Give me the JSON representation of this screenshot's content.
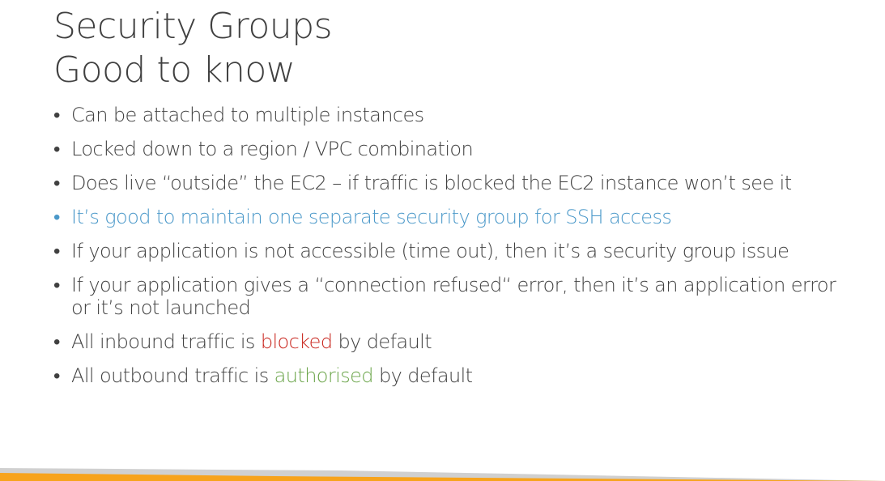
{
  "slide": {
    "title_line1": "Security Groups",
    "title_line2": "Good to know",
    "bullet_char": "•",
    "bullets": [
      {
        "text": "Can be attached to multiple instances"
      },
      {
        "text": "Locked down to a region / VPC combination"
      },
      {
        "text": "Does live “outside” the EC2 – if traffic is blocked the EC2 instance won’t see it"
      },
      {
        "text": "It’s good to maintain one separate security group for SSH access"
      },
      {
        "text": "If your application is not accessible (time out), then it’s a security group issue"
      },
      {
        "text": "If your application gives a “connection refused“ error, then it’s an application error or it’s not launched"
      },
      {
        "before": "All inbound traffic is ",
        "highlight": "blocked",
        "after": " by default"
      },
      {
        "before": "All outbound traffic is ",
        "highlight": "authorised",
        "after": " by default"
      }
    ]
  },
  "colors": {
    "text": "#404040",
    "highlight_blue": "#4a98c9",
    "blocked_red": "#c8251d",
    "authorised_green": "#6ba54a",
    "bar_orange": "#f7a31c",
    "bar_gray": "#d0d0d0"
  }
}
